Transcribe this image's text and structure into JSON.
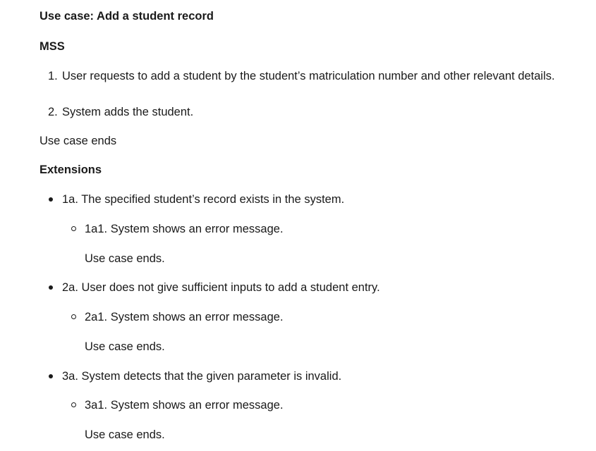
{
  "heading": "Use case: Add a student record",
  "mss": {
    "title": "MSS",
    "steps": [
      "User requests to add a student by the student’s matriculation number and other relevant details.",
      "System adds the student."
    ],
    "step_numbers": [
      "1.",
      "2."
    ]
  },
  "end_text": "Use case ends",
  "extensions": {
    "title": "Extensions",
    "items": [
      {
        "label": "1a. The specified student’s record exists in the system.",
        "sub": {
          "label": "1a1. System shows an error message.",
          "end": "Use case ends."
        }
      },
      {
        "label": "2a. User does not give sufficient inputs to add a student entry.",
        "sub": {
          "label": "2a1. System shows an error message.",
          "end": "Use case ends."
        }
      },
      {
        "label": "3a. System detects that the given parameter is invalid.",
        "sub": {
          "label": "3a1. System shows an error message.",
          "end": "Use case ends."
        }
      }
    ]
  }
}
